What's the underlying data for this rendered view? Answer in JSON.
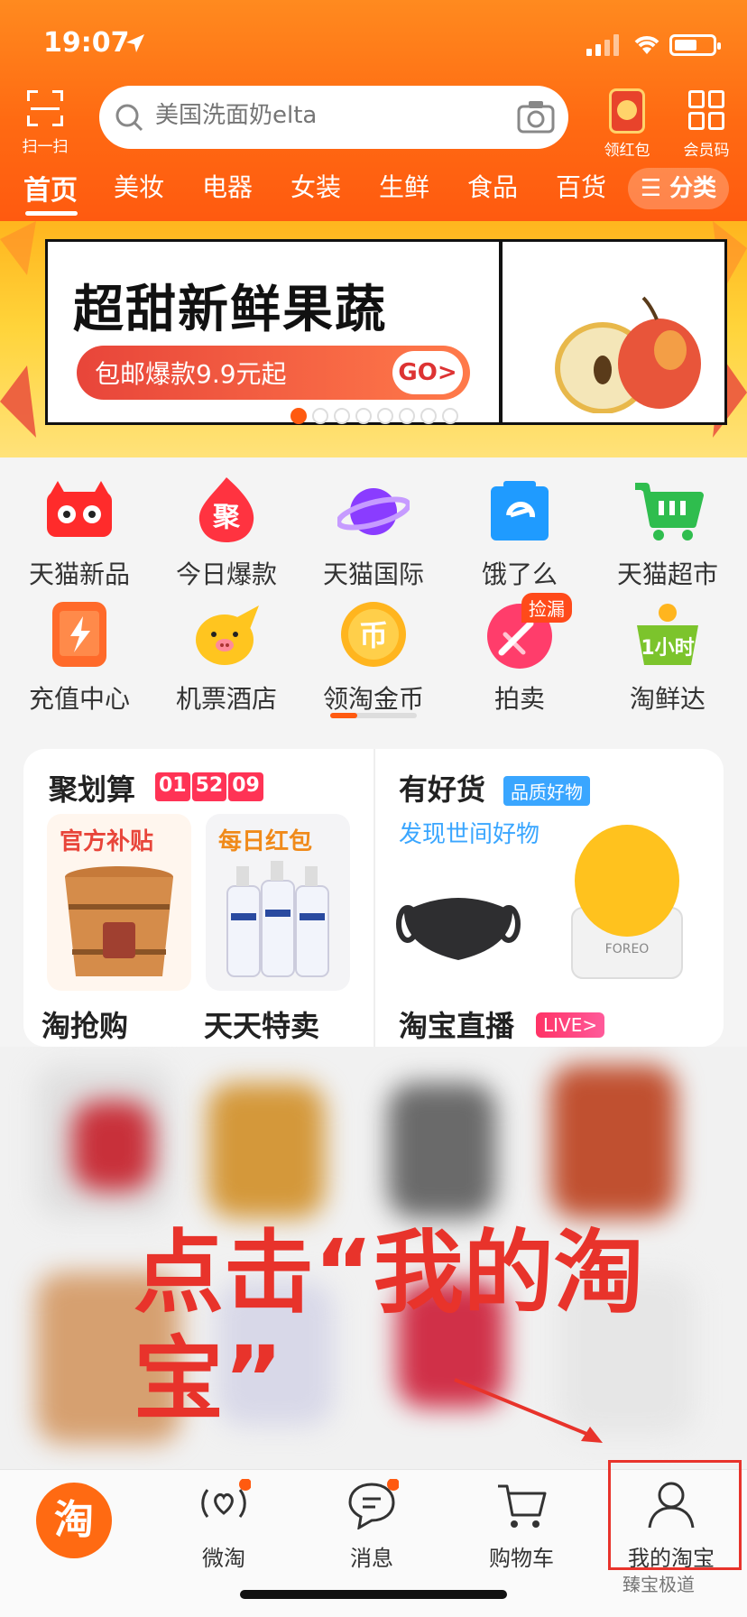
{
  "status_bar": {
    "time": "19:07"
  },
  "header": {
    "scan_label": "扫一扫",
    "search_placeholder": "美国洗面奶elta",
    "redpack_label": "领红包",
    "member_label": "会员码",
    "tabs": [
      "首页",
      "美妆",
      "电器",
      "女装",
      "生鲜",
      "食品",
      "百货"
    ],
    "category_label": "☰ 分类"
  },
  "banner": {
    "title": "超甜新鲜果蔬",
    "subtitle": "包邮爆款9.9元起",
    "cta": "GO>",
    "slide_count": 8,
    "active_slide": 1
  },
  "grid": [
    {
      "label": "天猫新品",
      "icon": "tmall-cat-icon",
      "color": "#ff2b2b"
    },
    {
      "label": "今日爆款",
      "icon": "flame-ju-icon",
      "color": "#ff3340"
    },
    {
      "label": "天猫国际",
      "icon": "planet-icon",
      "color": "#8a3cff"
    },
    {
      "label": "饿了么",
      "icon": "eleme-bag-icon",
      "color": "#1f9bff"
    },
    {
      "label": "天猫超市",
      "icon": "shopping-cart-icon",
      "color": "#2fbd4e"
    },
    {
      "label": "充值中心",
      "icon": "phone-charge-icon",
      "color": "#ff6a2a"
    },
    {
      "label": "机票酒店",
      "icon": "flying-pig-icon",
      "color": "#ffc51f"
    },
    {
      "label": "领淘金币",
      "icon": "gold-coin-icon",
      "color": "#ffb51e"
    },
    {
      "label": "拍卖",
      "icon": "auction-hammer-icon",
      "color": "#ff3d6b",
      "badge": "捡漏"
    },
    {
      "label": "淘鲜达",
      "icon": "fresh-basket-icon",
      "color": "#7cc42c"
    }
  ],
  "cards": {
    "juhuasuan": {
      "title": "聚划算",
      "timer": [
        "01",
        "52",
        "09"
      ]
    },
    "box1_label": "官方补贴",
    "box2_label": "每日红包",
    "youhaohuo": {
      "title": "有好货",
      "badge": "品质好物",
      "subtitle": "发现世间好物"
    },
    "taoqianggou": "淘抢购",
    "tiantiantemai": "天天特卖",
    "live": {
      "title": "淘宝直播",
      "badge": "LIVE>"
    }
  },
  "annotation": {
    "text": "点击“我的淘宝”"
  },
  "bottom_nav": {
    "home_logo": "淘",
    "items": [
      {
        "label": "微淘"
      },
      {
        "label": "消息"
      },
      {
        "label": "购物车"
      },
      {
        "label": "我的淘宝"
      }
    ]
  },
  "watermark": "臻宝极道"
}
